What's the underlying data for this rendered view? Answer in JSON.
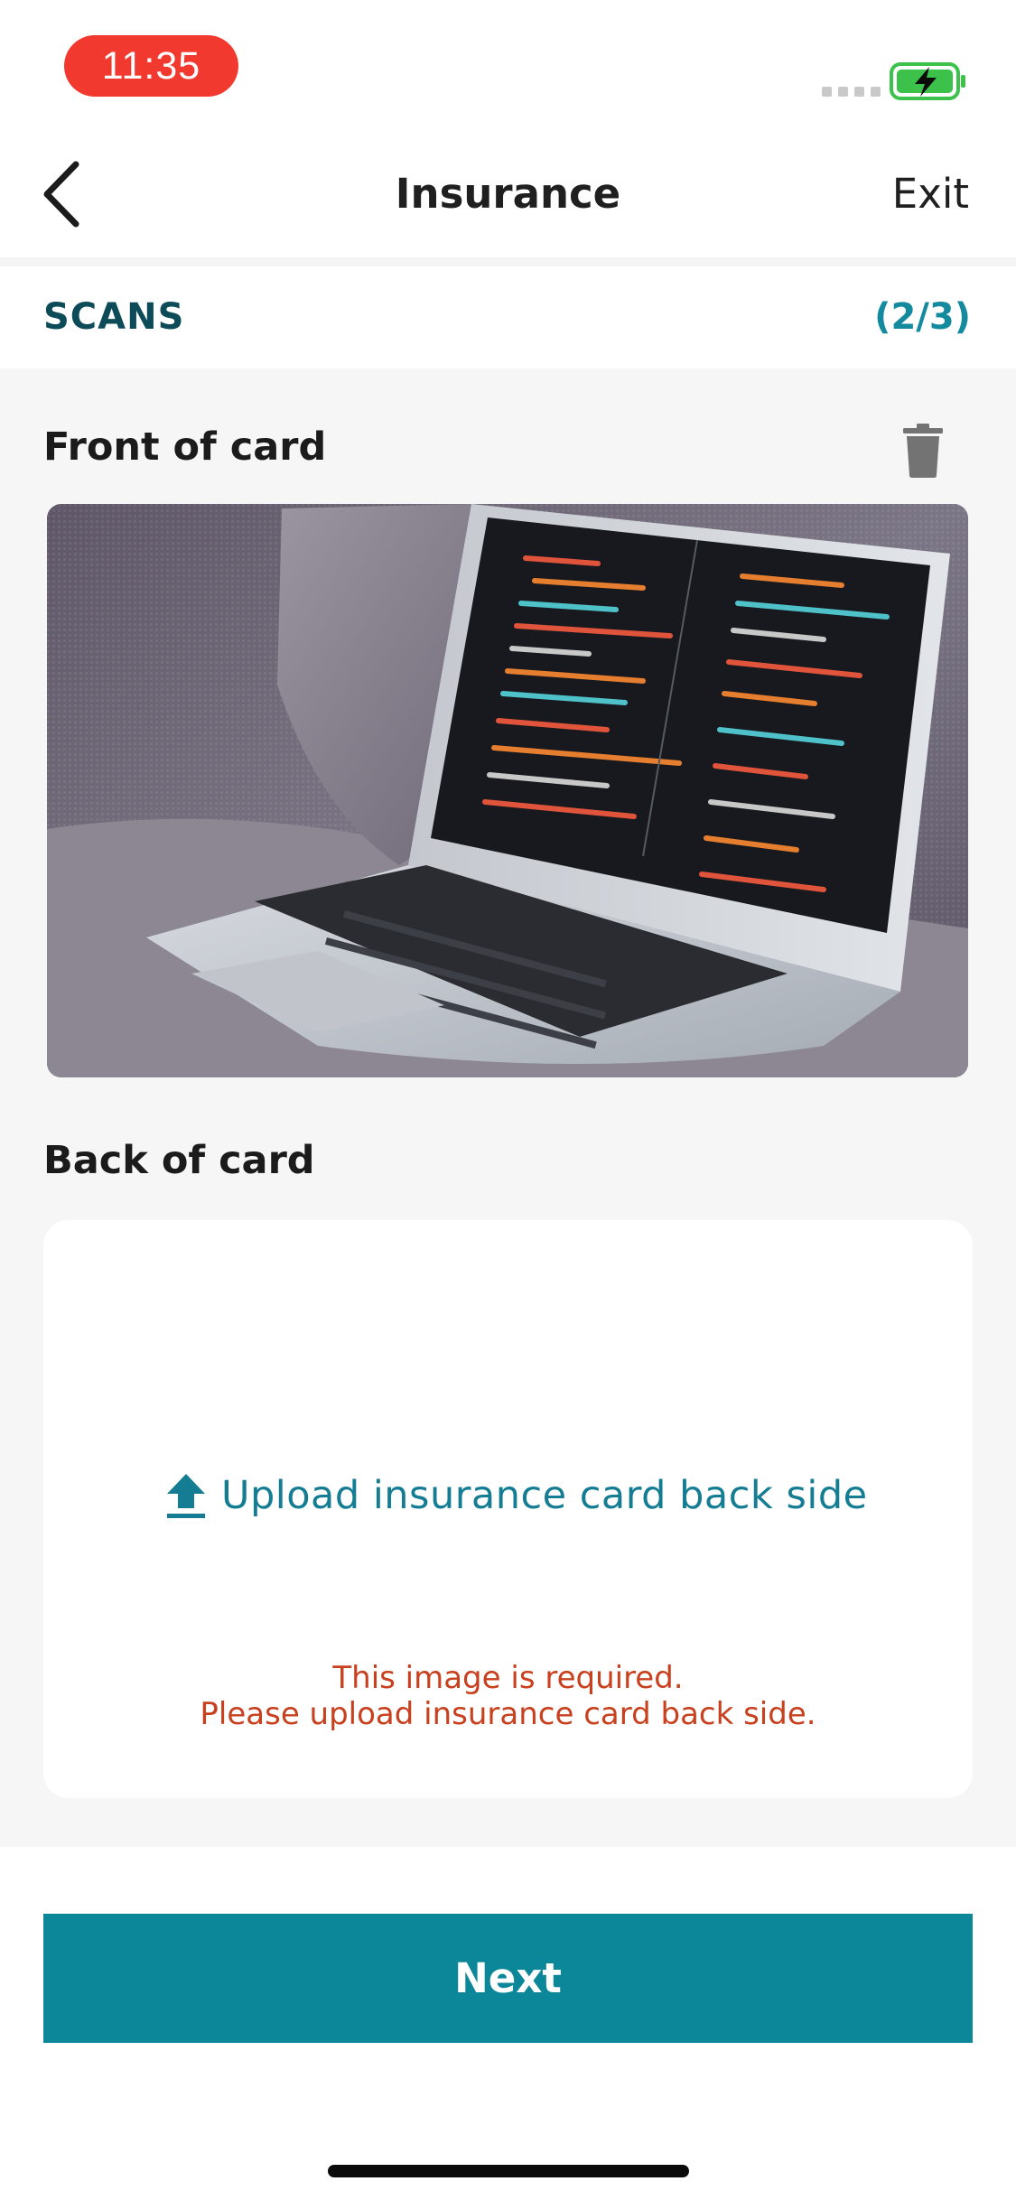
{
  "status_bar": {
    "time": "11:35",
    "signal_icon": "cellular-signal-icon",
    "battery_icon": "battery-charging-icon",
    "battery_color": "#3cc24a"
  },
  "nav": {
    "back_icon": "chevron-left-icon",
    "title": "Insurance",
    "exit_label": "Exit"
  },
  "scans": {
    "label": "SCANS",
    "count": "(2/3)"
  },
  "front": {
    "title": "Front of card",
    "delete_icon": "trash-icon",
    "image_alt": ""
  },
  "back": {
    "title": "Back of card",
    "upload_icon": "upload-icon",
    "upload_label": "Upload insurance card back side",
    "error_line1": "This image is required.",
    "error_line2": "Please upload insurance card back side."
  },
  "footer": {
    "next_label": "Next"
  },
  "colors": {
    "brand_teal": "#0b8799",
    "link_teal": "#147c93",
    "error_red": "#c8401e",
    "time_pill_red": "#f1392f",
    "scans_dark": "#0d4b58"
  }
}
